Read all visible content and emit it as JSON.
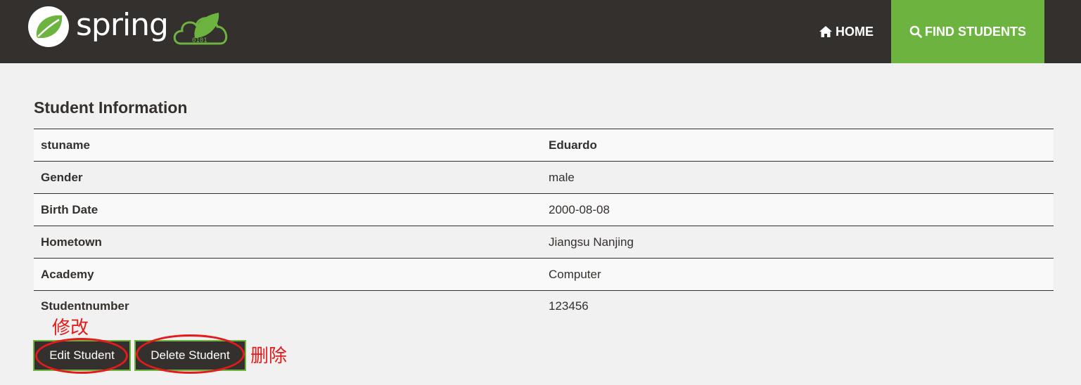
{
  "navbar": {
    "brand_text": "spring",
    "home_label": "HOME",
    "find_label": "FIND STUDENTS",
    "accent": "#6db33f",
    "background": "#34302d"
  },
  "main": {
    "title": "Student Information",
    "rows": [
      {
        "label": "stuname",
        "value": "Eduardo"
      },
      {
        "label": "Gender",
        "value": "male"
      },
      {
        "label": "Birth Date",
        "value": "2000-08-08"
      },
      {
        "label": "Hometown",
        "value": "Jiangsu Nanjing"
      },
      {
        "label": "Academy",
        "value": "Computer"
      },
      {
        "label": "Studentnumber",
        "value": "123456"
      }
    ],
    "edit_button": "Edit Student",
    "delete_button": "Delete Student"
  },
  "annotations": {
    "edit_note": "修改",
    "delete_note": "删除",
    "color": "#e51a1a"
  },
  "icons": {
    "home": "home-icon",
    "search": "search-icon",
    "logo": "spring-leaf-icon"
  }
}
